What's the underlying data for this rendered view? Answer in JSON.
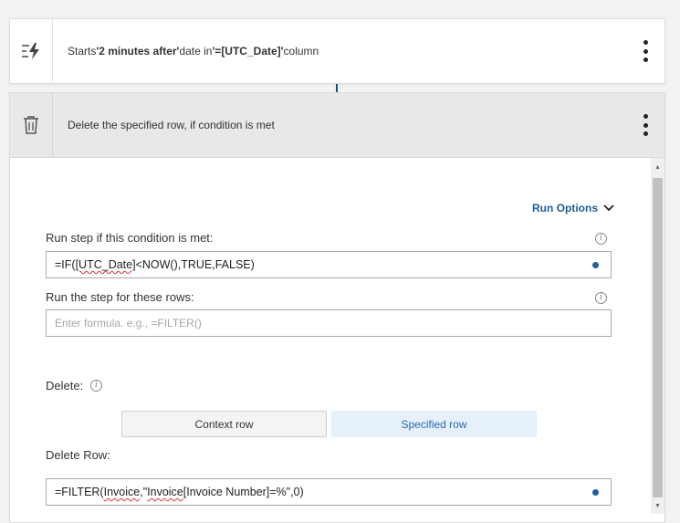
{
  "trigger": {
    "icon": "lightning-icon",
    "starts": "Starts",
    "offset": "'2 minutes after'",
    "date_in": "date in",
    "column": "'=[UTC_Date]'",
    "column_word": "column"
  },
  "action": {
    "icon": "trash-icon",
    "title": "Delete the specified row, if condition is met"
  },
  "run_options": {
    "label": "Run Options"
  },
  "condition": {
    "label": "Run step if this condition is met:",
    "prefix": "=IF(",
    "ref": "[UTC_Date]",
    "suffix": "<NOW(),TRUE,FALSE)"
  },
  "rows": {
    "label": "Run the step for these rows:",
    "placeholder": "Enter formula. e.g., =FILTER()"
  },
  "delete": {
    "label": "Delete:",
    "options": [
      "Context row",
      "Specified row"
    ],
    "selected": "Specified row"
  },
  "delete_row": {
    "label": "Delete Row:",
    "prefix": "=FILTER(",
    "table": "Invoice",
    "mid": ",\"",
    "ref": "Invoice",
    "suffix": "[Invoice Number]=%\",0)"
  },
  "colors": {
    "accent": "#1f5c99",
    "selected_bg": "#e5f0fa",
    "header_bg": "#e8e8e8"
  }
}
